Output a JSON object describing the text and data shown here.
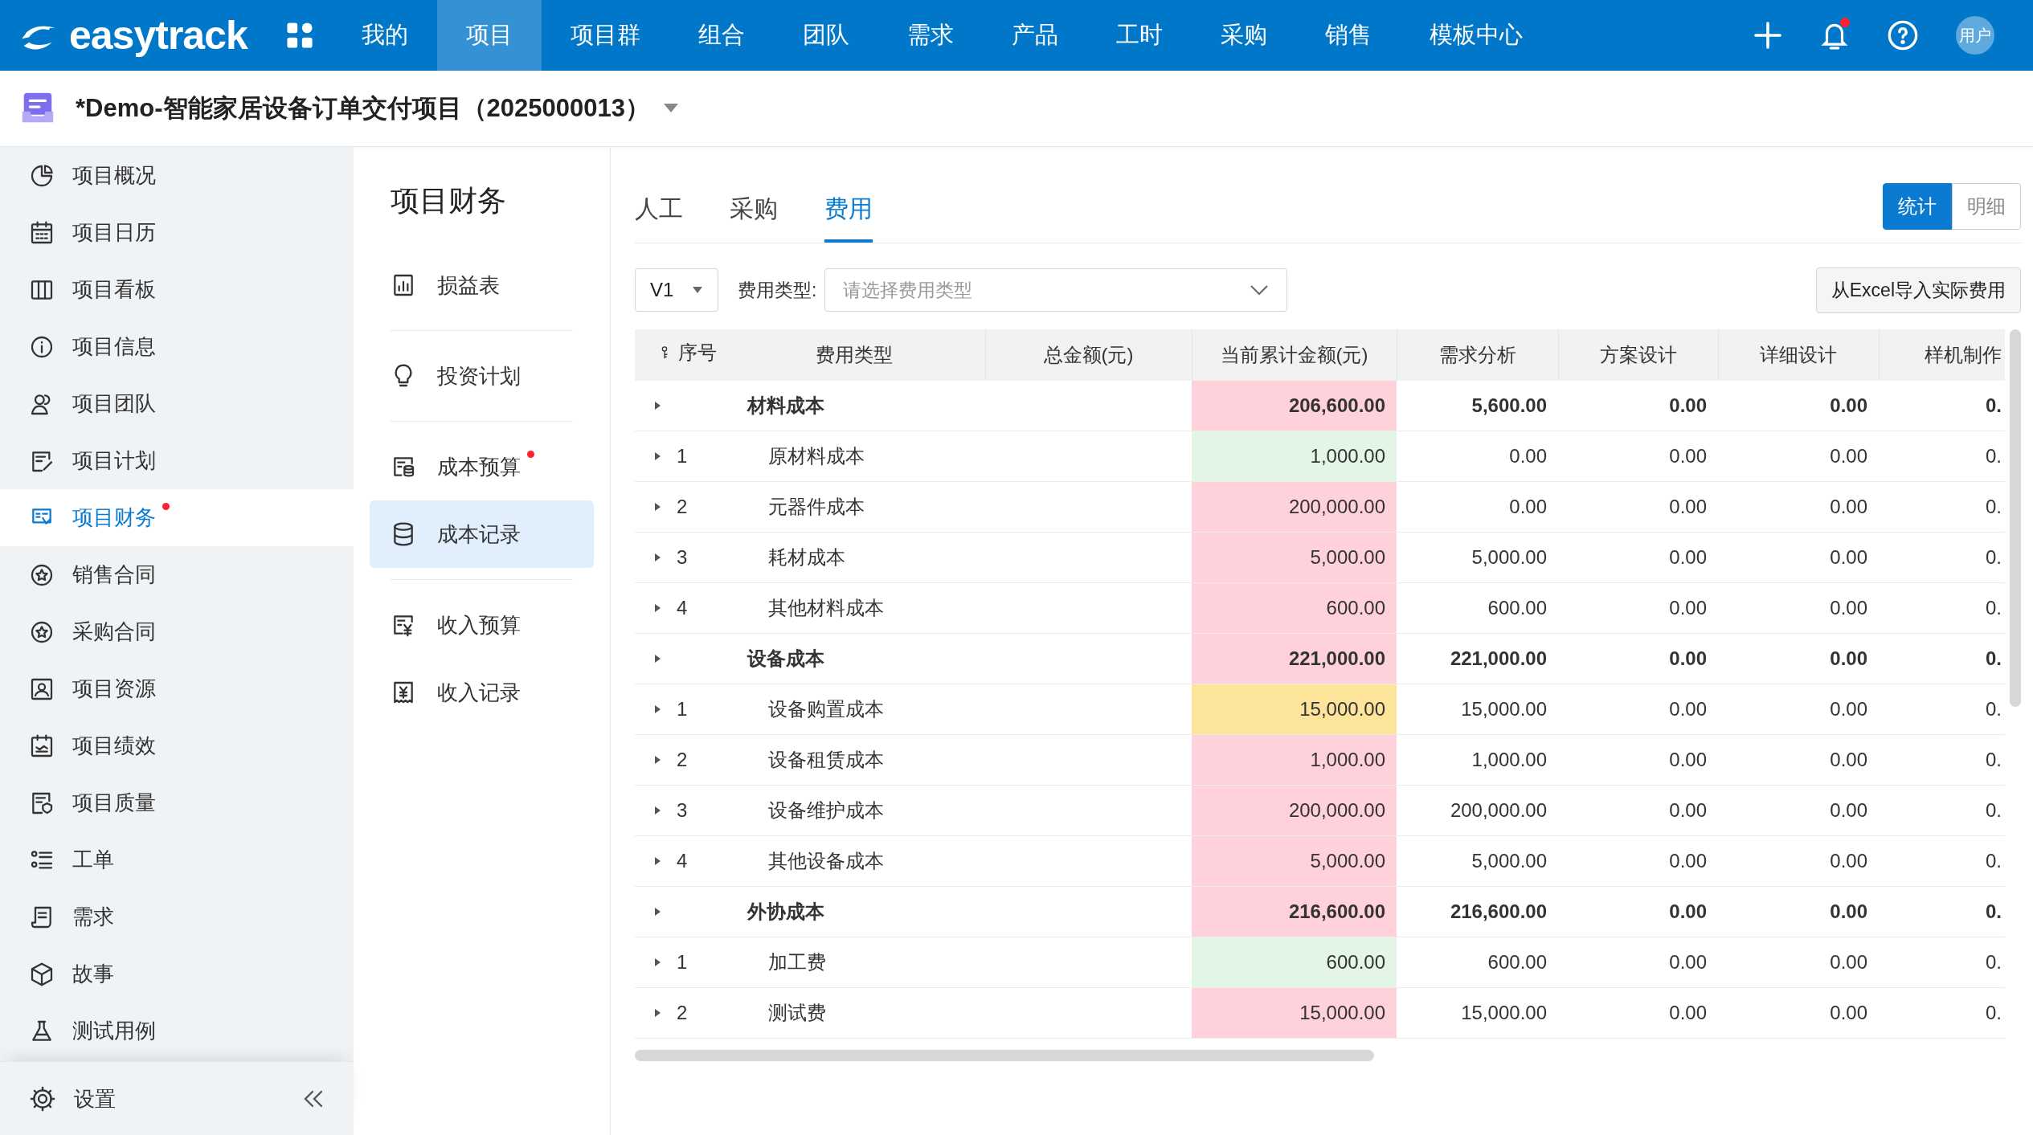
{
  "topnav": {
    "logo": "easytrack",
    "items": [
      {
        "label": "我的",
        "selected": false
      },
      {
        "label": "项目",
        "selected": true
      },
      {
        "label": "项目群",
        "selected": false
      },
      {
        "label": "组合",
        "selected": false
      },
      {
        "label": "团队",
        "selected": false
      },
      {
        "label": "需求",
        "selected": false
      },
      {
        "label": "产品",
        "selected": false
      },
      {
        "label": "工时",
        "selected": false
      },
      {
        "label": "采购",
        "selected": false
      },
      {
        "label": "销售",
        "selected": false
      },
      {
        "label": "模板中心",
        "selected": false
      }
    ],
    "notification": true,
    "avatar": "用户"
  },
  "project": {
    "title": "*Demo-智能家居设备订单交付项目（2025000013）"
  },
  "sidebar": {
    "items": [
      {
        "label": "项目概况",
        "selected": false,
        "badge": false
      },
      {
        "label": "项目日历",
        "selected": false,
        "badge": false
      },
      {
        "label": "项目看板",
        "selected": false,
        "badge": false
      },
      {
        "label": "项目信息",
        "selected": false,
        "badge": false
      },
      {
        "label": "项目团队",
        "selected": false,
        "badge": false
      },
      {
        "label": "项目计划",
        "selected": false,
        "badge": false
      },
      {
        "label": "项目财务",
        "selected": true,
        "badge": true
      },
      {
        "label": "销售合同",
        "selected": false,
        "badge": false
      },
      {
        "label": "采购合同",
        "selected": false,
        "badge": false
      },
      {
        "label": "项目资源",
        "selected": false,
        "badge": false
      },
      {
        "label": "项目绩效",
        "selected": false,
        "badge": false
      },
      {
        "label": "项目质量",
        "selected": false,
        "badge": false
      },
      {
        "label": "工单",
        "selected": false,
        "badge": false
      },
      {
        "label": "需求",
        "selected": false,
        "badge": false
      },
      {
        "label": "故事",
        "selected": false,
        "badge": false
      },
      {
        "label": "测试用例",
        "selected": false,
        "badge": false
      }
    ],
    "footer": "设置"
  },
  "subnav": {
    "title": "项目财务",
    "sections": [
      [
        {
          "label": "损益表",
          "selected": false,
          "badge": false
        }
      ],
      [
        {
          "label": "投资计划",
          "selected": false,
          "badge": false
        }
      ],
      [
        {
          "label": "成本预算",
          "selected": false,
          "badge": true
        },
        {
          "label": "成本记录",
          "selected": true,
          "badge": false
        }
      ],
      [
        {
          "label": "收入预算",
          "selected": false,
          "badge": false
        },
        {
          "label": "收入记录",
          "selected": false,
          "badge": false
        }
      ]
    ]
  },
  "tabs": [
    {
      "label": "人工",
      "selected": false
    },
    {
      "label": "采购",
      "selected": false
    },
    {
      "label": "费用",
      "selected": true
    }
  ],
  "view_toggle": [
    {
      "label": "统计",
      "selected": true
    },
    {
      "label": "明细",
      "selected": false
    }
  ],
  "filters": {
    "version": "V1",
    "type_label": "费用类型:",
    "type_placeholder": "请选择费用类型"
  },
  "import_button": "从Excel导入实际费用",
  "table": {
    "columns": [
      "序号",
      "费用类型",
      "总金额(元)",
      "当前累计金额(元)",
      "需求分析",
      "方案设计",
      "详细设计",
      "样机制作"
    ],
    "rows": [
      {
        "kind": "group",
        "name": "材料成本",
        "expanded": false,
        "color": "#ffd1da",
        "values": [
          "206,600.00",
          "5,600.00",
          "0.00",
          "0.00",
          "0."
        ]
      },
      {
        "kind": "item",
        "index": "1",
        "name": "原材料成本",
        "expanded": false,
        "color": "#e3f6e6",
        "values": [
          "1,000.00",
          "0.00",
          "0.00",
          "0.00",
          "0."
        ]
      },
      {
        "kind": "item",
        "index": "2",
        "name": "元器件成本",
        "expanded": false,
        "color": "#ffd1da",
        "values": [
          "200,000.00",
          "0.00",
          "0.00",
          "0.00",
          "0."
        ]
      },
      {
        "kind": "item",
        "index": "3",
        "name": "耗材成本",
        "expanded": false,
        "color": "#ffd1da",
        "values": [
          "5,000.00",
          "5,000.00",
          "0.00",
          "0.00",
          "0."
        ]
      },
      {
        "kind": "item",
        "index": "4",
        "name": "其他材料成本",
        "expanded": false,
        "color": "#ffd1da",
        "values": [
          "600.00",
          "600.00",
          "0.00",
          "0.00",
          "0."
        ]
      },
      {
        "kind": "group",
        "name": "设备成本",
        "expanded": false,
        "color": "#ffd1da",
        "values": [
          "221,000.00",
          "221,000.00",
          "0.00",
          "0.00",
          "0."
        ]
      },
      {
        "kind": "item",
        "index": "1",
        "name": "设备购置成本",
        "expanded": false,
        "color": "#fde49b",
        "values": [
          "15,000.00",
          "15,000.00",
          "0.00",
          "0.00",
          "0."
        ]
      },
      {
        "kind": "item",
        "index": "2",
        "name": "设备租赁成本",
        "expanded": false,
        "color": "#ffd1da",
        "values": [
          "1,000.00",
          "1,000.00",
          "0.00",
          "0.00",
          "0."
        ]
      },
      {
        "kind": "item",
        "index": "3",
        "name": "设备维护成本",
        "expanded": false,
        "color": "#ffd1da",
        "values": [
          "200,000.00",
          "200,000.00",
          "0.00",
          "0.00",
          "0."
        ]
      },
      {
        "kind": "item",
        "index": "4",
        "name": "其他设备成本",
        "expanded": false,
        "color": "#ffd1da",
        "values": [
          "5,000.00",
          "5,000.00",
          "0.00",
          "0.00",
          "0."
        ]
      },
      {
        "kind": "group",
        "name": "外协成本",
        "expanded": false,
        "color": "#ffd1da",
        "values": [
          "216,600.00",
          "216,600.00",
          "0.00",
          "0.00",
          "0."
        ]
      },
      {
        "kind": "item",
        "index": "1",
        "name": "加工费",
        "expanded": false,
        "color": "#e3f6e6",
        "values": [
          "600.00",
          "600.00",
          "0.00",
          "0.00",
          "0."
        ]
      },
      {
        "kind": "item",
        "index": "2",
        "name": "测试费",
        "expanded": false,
        "color": "#ffd1da",
        "values": [
          "15,000.00",
          "15,000.00",
          "0.00",
          "0.00",
          "0."
        ]
      }
    ]
  }
}
